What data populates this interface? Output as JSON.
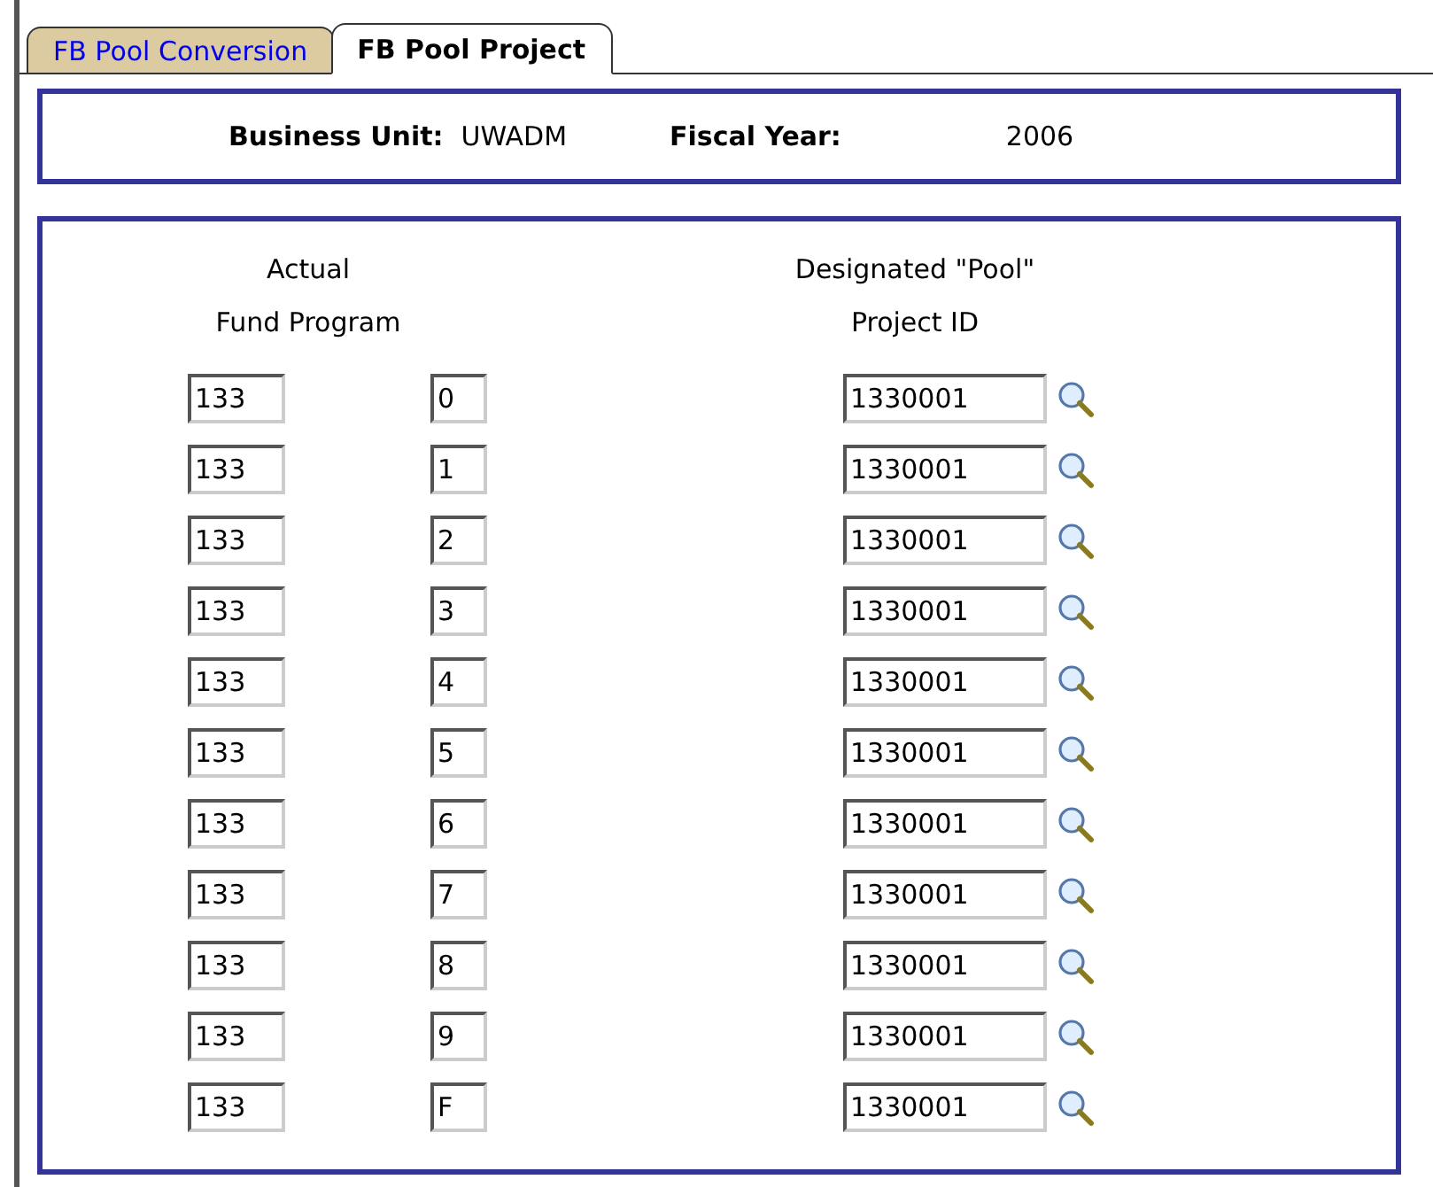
{
  "tabs": [
    {
      "label": "FB Pool Conversion",
      "selected": false
    },
    {
      "label": "FB Pool Project",
      "selected": true
    }
  ],
  "header": {
    "business_unit_label": "Business Unit:",
    "business_unit": "UWADM",
    "fiscal_year_label": "Fiscal Year:",
    "fiscal_year": "2006"
  },
  "columns": {
    "fund_program": [
      "Actual",
      "Fund Program"
    ],
    "project": [
      "Designated \"Pool\"",
      "Project ID"
    ]
  },
  "rows": [
    {
      "fund": "133",
      "program": "0",
      "project": "1330001"
    },
    {
      "fund": "133",
      "program": "1",
      "project": "1330001"
    },
    {
      "fund": "133",
      "program": "2",
      "project": "1330001"
    },
    {
      "fund": "133",
      "program": "3",
      "project": "1330001"
    },
    {
      "fund": "133",
      "program": "4",
      "project": "1330001"
    },
    {
      "fund": "133",
      "program": "5",
      "project": "1330001"
    },
    {
      "fund": "133",
      "program": "6",
      "project": "1330001"
    },
    {
      "fund": "133",
      "program": "7",
      "project": "1330001"
    },
    {
      "fund": "133",
      "program": "8",
      "project": "1330001"
    },
    {
      "fund": "133",
      "program": "9",
      "project": "1330001"
    },
    {
      "fund": "133",
      "program": "F",
      "project": "1330001"
    }
  ]
}
